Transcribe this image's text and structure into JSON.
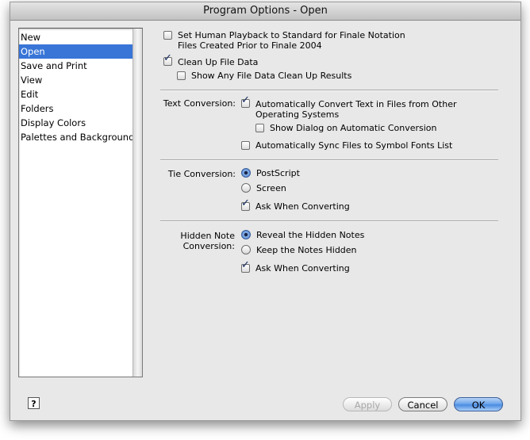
{
  "window": {
    "title": "Program Options - Open"
  },
  "sidebar": {
    "items": [
      {
        "label": "New",
        "selected": false
      },
      {
        "label": "Open",
        "selected": true
      },
      {
        "label": "Save and Print",
        "selected": false
      },
      {
        "label": "View",
        "selected": false
      },
      {
        "label": "Edit",
        "selected": false
      },
      {
        "label": "Folders",
        "selected": false
      },
      {
        "label": "Display Colors",
        "selected": false
      },
      {
        "label": "Palettes and Backgrounds",
        "selected": false
      }
    ]
  },
  "general": {
    "human_playback": {
      "line1": "Set Human Playback to Standard for Finale Notation",
      "line2": "Files Created Prior to Finale 2004",
      "checked": false
    },
    "clean_up": {
      "label": "Clean Up File Data",
      "checked": true
    },
    "show_results": {
      "label": "Show Any File Data Clean Up Results",
      "checked": false
    }
  },
  "text_conversion": {
    "label": "Text Conversion:",
    "auto_convert": {
      "line1": "Automatically Convert Text in Files from Other",
      "line2": "Operating Systems",
      "checked": true
    },
    "show_dialog": {
      "label": "Show Dialog on Automatic Conversion",
      "checked": false
    },
    "sync_fonts": {
      "label": "Automatically Sync Files to Symbol Fonts List",
      "checked": false
    }
  },
  "tie_conversion": {
    "label": "Tie Conversion:",
    "postscript": {
      "label": "PostScript",
      "selected": true
    },
    "screen": {
      "label": "Screen",
      "selected": false
    },
    "ask": {
      "label": "Ask When Converting",
      "checked": true
    }
  },
  "hidden_note": {
    "label_line1": "Hidden Note",
    "label_line2": "Conversion:",
    "reveal": {
      "label": "Reveal the Hidden Notes",
      "selected": true
    },
    "keep": {
      "label": "Keep the Notes Hidden",
      "selected": false
    },
    "ask": {
      "label": "Ask When Converting",
      "checked": true
    }
  },
  "buttons": {
    "help": "?",
    "apply": "Apply",
    "cancel": "Cancel",
    "ok": "OK"
  },
  "check_glyph": "✓"
}
